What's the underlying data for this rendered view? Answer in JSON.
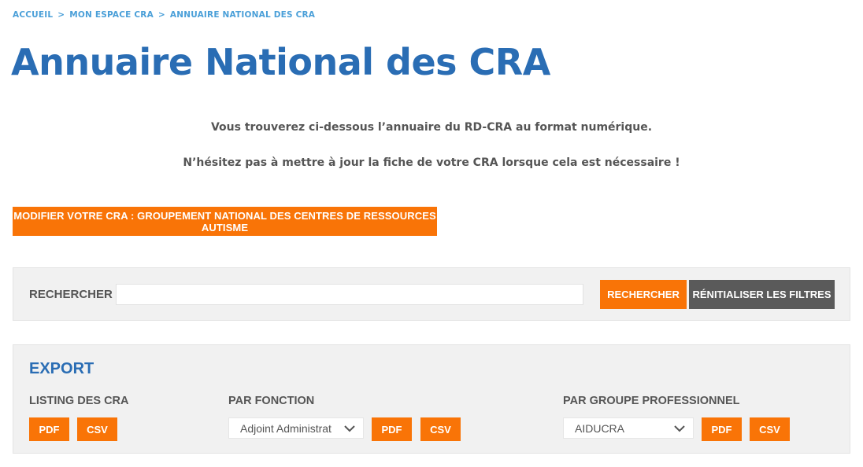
{
  "breadcrumb": {
    "items": [
      "ACCUEIL",
      "MON ESPACE CRA",
      "ANNUAIRE NATIONAL DES CRA"
    ],
    "separator": ">"
  },
  "page": {
    "title": "Annuaire National des CRA",
    "intro_line1": "Vous trouverez ci-dessous l’annuaire du RD-CRA au format numérique.",
    "intro_line2": "N’hésitez pas à mettre à jour la fiche de votre CRA lorsque cela est nécessaire !"
  },
  "modify_button": {
    "label": "MODIFIER VOTRE CRA : GROUPEMENT NATIONAL DES CENTRES DE RESSOURCES AUTISME"
  },
  "search": {
    "label": "RECHERCHER",
    "value": "",
    "button": "RECHERCHER",
    "reset_button": "RÉNITIALISER LES FILTRES"
  },
  "export": {
    "title": "EXPORT",
    "listing": {
      "label": "LISTING DES CRA",
      "pdf": "PDF",
      "csv": "CSV"
    },
    "fonction": {
      "label": "PAR FONCTION",
      "selected": "Adjoint Administrat",
      "pdf": "PDF",
      "csv": "CSV"
    },
    "groupe": {
      "label": "PAR GROUPE PROFESSIONNEL",
      "selected": "AIDUCRA",
      "pdf": "PDF",
      "csv": "CSV"
    }
  },
  "colors": {
    "accent_orange": "#f97407",
    "title_blue": "#2a6db4",
    "breadcrumb_blue": "#4a9fd8",
    "grey_button": "#5a5a5a",
    "panel_bg": "#f1f1f1"
  },
  "icons": {
    "select_arrow": "chevron-down-icon"
  }
}
